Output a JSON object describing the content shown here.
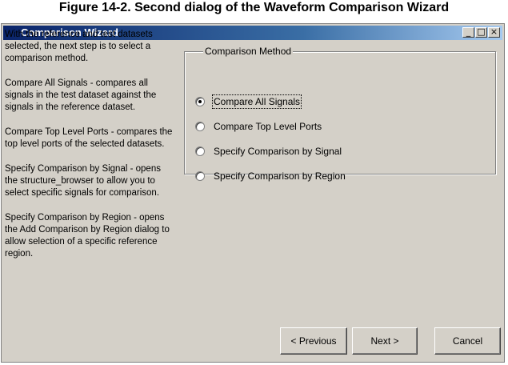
{
  "caption": "Figure 14-2. Second dialog of the Waveform Comparison Wizard",
  "window": {
    "title": "Comparison Wizard",
    "controls": {
      "minimize": "_",
      "maximize": "□",
      "close": "×"
    }
  },
  "description": [
    "With the reference and test datasets selected, the next step is to select a comparison method.",
    "Compare All Signals - compares all signals in the test dataset against the signals in the reference dataset.",
    "Compare Top Level Ports - compares the top level ports of the selected datasets.",
    "Specify Comparison by Signal - opens the structure_browser to allow you to select specific signals for comparison.",
    "Specify Comparison by Region - opens the Add Comparison by Region dialog to allow selection of a specific reference region."
  ],
  "comparison_method": {
    "legend": "Comparison Method",
    "options": [
      {
        "label": "Compare All Signals",
        "selected": true
      },
      {
        "label": "Compare Top Level Ports",
        "selected": false
      },
      {
        "label": "Specify Comparison by Signal",
        "selected": false
      },
      {
        "label": "Specify Comparison by Region",
        "selected": false
      }
    ]
  },
  "buttons": {
    "previous": "< Previous",
    "next": "Next >",
    "cancel": "Cancel"
  }
}
